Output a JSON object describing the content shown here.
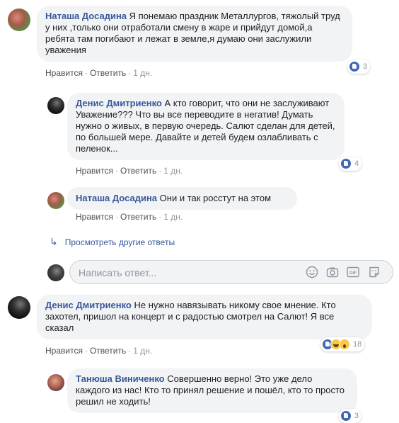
{
  "comments": [
    {
      "author": "Наташа Досадина",
      "text": "Я понемаю праздник Металлургов, тяжолый труд у них ,только они отработали смену в жаре и прийдут домой,а ребята там погибают и лежат в земле,я думаю они заслужили уважения",
      "like": "Нравится",
      "reply": "Ответить",
      "time": "1 дн.",
      "reactions_count": "3"
    },
    {
      "author": "Денис Дмитриенко",
      "text": "А кто говорит, что они не заслуживают Уважение??? Что вы все переводите в негатив! Думать нужно о живых, в первую очередь. Салют сделан для детей, по большей мере. Давайте и детей будем озлабливать с пеленок...",
      "like": "Нравится",
      "reply": "Ответить",
      "time": "1 дн.",
      "reactions_count": "4"
    },
    {
      "author": "Наташа Досадина",
      "text": "Они и так росстут на этом",
      "like": "Нравится",
      "reply": "Ответить",
      "time": "1 дн."
    },
    {
      "author": "Денис Дмитриенко",
      "text": "Не нужно навязывать никому свое мнение. Кто захотел, пришол на концерт и с радостью смотрел на Салют! Я все сказал",
      "like": "Нравится",
      "reply": "Ответить",
      "time": "1 дн.",
      "reactions_count": "18"
    },
    {
      "author": "Танюша Виниченко",
      "text": "Совершенно верно! Это уже дело каждого из нас! Кто то принял решение и пошёл, кто то просто решил не ходить!",
      "reactions_count": "3"
    }
  ],
  "more_replies": "Просмотреть другие ответы",
  "reply_input": {
    "placeholder": "Написать ответ..."
  },
  "icons": {
    "emoji": "smiley-icon",
    "photo": "camera-icon",
    "gif": "gif-icon",
    "sticker": "sticker-icon"
  },
  "colors": {
    "author": "#385898",
    "like_blue": "#4267b2",
    "bubble": "#f2f3f5"
  }
}
